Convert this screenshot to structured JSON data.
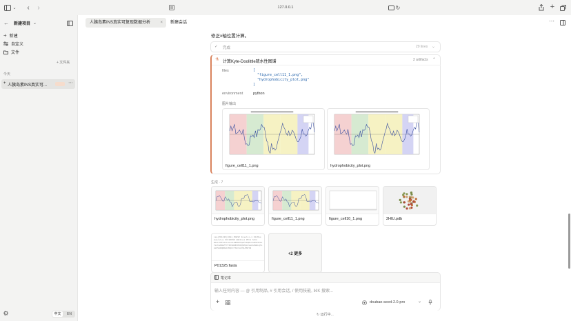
{
  "browser": {
    "url": "127.0.0.1"
  },
  "sidebar": {
    "project_title": "新建项目",
    "new_label": "新建",
    "custom_label": "自定义",
    "files_label": "文件",
    "add_folder": "+ 文件夹",
    "today": "今天",
    "chat_title": "人胰岛素INS真实可...",
    "lang_zh": "中文",
    "lang_en": "EN"
  },
  "tabs": [
    {
      "label": "人胰岛素INS真实可复现数据分析"
    },
    {
      "label": "新建会话"
    }
  ],
  "main": {
    "intro_text": "修正x轴位置计算。",
    "collapsed_label": "完成",
    "collapsed_lines": "29 lines",
    "tool": {
      "title": "计算Kyte-Doolittle疏水性图谱",
      "artifacts": "2 artifacts",
      "files_key": "files",
      "files_lines": [
        "[",
        "\"figure_cell11_1.png\",",
        "\"hydrophobicity_plot.png\"",
        "]"
      ],
      "env_key": "environment",
      "env_val": "python",
      "output_label": "图片输出",
      "images": [
        {
          "caption": "figure_cell11_1.png"
        },
        {
          "caption": "hydrophobicity_plot.png"
        }
      ]
    },
    "gallery_label": "生成 · 7",
    "gallery": [
      {
        "caption": "hydrophobicity_plot.png"
      },
      {
        "caption": "figure_cell11_1.png"
      },
      {
        "caption": "figure_cell10_1.png"
      },
      {
        "caption": "2HIU.pdb"
      },
      {
        "caption": "P01325.fasta"
      },
      {
        "caption": "+2 更多"
      }
    ],
    "fasta_preview": ">sp|P01325|INS1_MOUSE Insulin-1 OS=Mus musculus OX=10090 GN=Ins1 PE=1 SV=1\nMALLVHFLPLLALLALWEPKPTQAFVKQHLCGPHLVEALYLVCGERGFFYTPKSRREVEDPQVEQLELGGSPGDLQTLALEVARQKRGIVDQCCTSICSLYQLENYCN"
  },
  "notebook": {
    "label": "笔记本",
    "placeholder": "输入任何内容 — @ 引用制品, # 引用会话, / 使用技能, ⌘K 搜索...",
    "model": "doubao-seed-2.0-pro",
    "status": "运行中..."
  },
  "colors": {
    "accent_border": "#d9825b",
    "region_red": "#f3c9c9",
    "region_green": "#cfe6c9",
    "region_yellow": "#f5f0b8",
    "region_blue": "#ccccf2",
    "line": "#3a4fa0"
  }
}
